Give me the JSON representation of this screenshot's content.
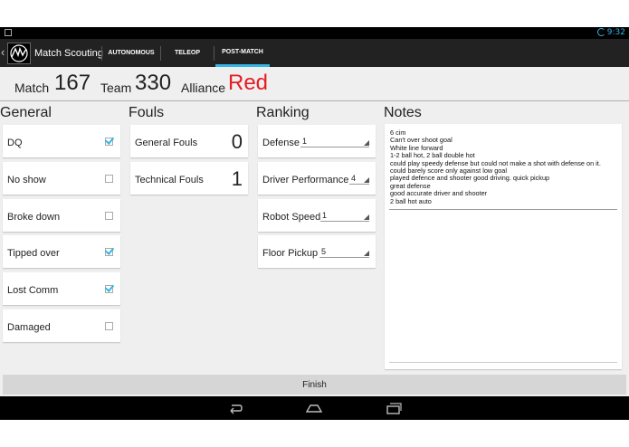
{
  "status": {
    "time": "9:32"
  },
  "app": {
    "title": "Match Scouting"
  },
  "tabs": [
    {
      "label": "AUTONOMOUS"
    },
    {
      "label": "TELEOP"
    },
    {
      "label": "POST-MATCH"
    }
  ],
  "match": {
    "match_label": "Match",
    "match_value": "167",
    "team_label": "Team",
    "team_value": "330",
    "alliance_label": "Alliance",
    "alliance_value": "Red",
    "alliance_color": "#e51c23"
  },
  "general": {
    "title": "General",
    "items": [
      {
        "label": "DQ",
        "checked": true
      },
      {
        "label": "No show",
        "checked": false
      },
      {
        "label": "Broke down",
        "checked": false
      },
      {
        "label": "Tipped over",
        "checked": true
      },
      {
        "label": "Lost Comm",
        "checked": true
      },
      {
        "label": "Damaged",
        "checked": false
      }
    ]
  },
  "fouls": {
    "title": "Fouls",
    "items": [
      {
        "label": "General Fouls",
        "value": "0"
      },
      {
        "label": "Technical Fouls",
        "value": "1"
      }
    ]
  },
  "ranking": {
    "title": "Ranking",
    "items": [
      {
        "label": "Defense",
        "value": "1"
      },
      {
        "label": "Driver Performance",
        "value": "4"
      },
      {
        "label": "Robot Speed",
        "value": "1"
      },
      {
        "label": "Floor Pickup",
        "value": "5"
      }
    ]
  },
  "notes": {
    "title": "Notes",
    "text": "6 cim\nCan't over shoot goal\nWhite line forward\n1-2 ball hot, 2 ball double hot\ncould play speedy defense but could not make a shot with defense on it.\ncould barely score only against low goal\nplayed defence and shooter good driving. quick pickup\ngreat defense\ngood accurate driver and shooter\n2 ball hot auto"
  },
  "finish": {
    "label": "Finish"
  },
  "colors": {
    "accent": "#33b5e5",
    "action_bar": "#222222",
    "background": "#efefef"
  },
  "nav_icons": [
    "back-icon",
    "home-icon",
    "recent-apps-icon"
  ]
}
